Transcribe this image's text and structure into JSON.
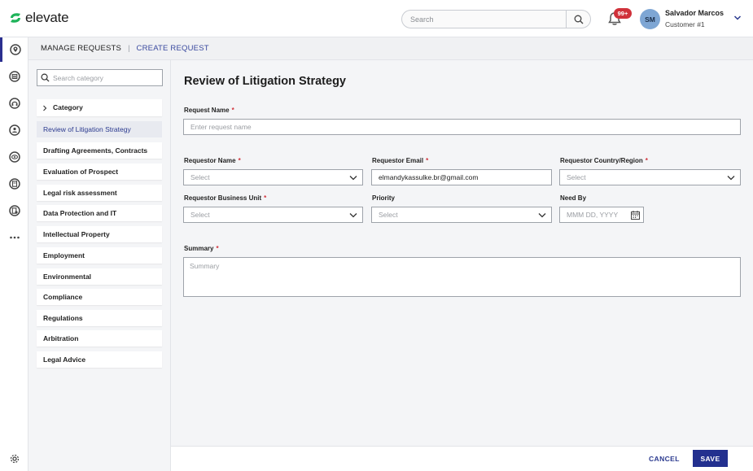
{
  "header": {
    "brand": "elevate",
    "search_placeholder": "Search",
    "notifications_badge": "99+",
    "user_initials": "SM",
    "user_name": "Salvador Marcos",
    "user_role": "Customer #1"
  },
  "breadcrumb": {
    "first": "MANAGE REQUESTS",
    "separator": "|",
    "second": "CREATE REQUEST"
  },
  "categories": {
    "search_placeholder": "Search category",
    "header_label": "Category",
    "items": [
      "Review of Litigation Strategy",
      "Drafting Agreements, Contracts",
      "Evaluation of Prospect",
      "Legal risk assessment",
      "Data Protection and IT",
      "Intellectual Property",
      "Employment",
      "Environmental",
      "Compliance",
      "Regulations",
      "Arbitration",
      "Legal Advice"
    ]
  },
  "form": {
    "title": "Review of Litigation Strategy",
    "request_name_label": "Request Name",
    "request_name_placeholder": "Enter request name",
    "requestor_name_label": "Requestor Name",
    "requestor_name_value": "Select",
    "requestor_email_label": "Requestor Email",
    "requestor_email_value": "elmandykassulke.br@gmail.com",
    "requestor_country_label": "Requestor Country/Region",
    "requestor_country_value": "Select",
    "business_unit_label": "Requestor Business Unit",
    "business_unit_value": "Select",
    "priority_label": "Priority",
    "priority_value": "Select",
    "need_by_label": "Need By",
    "need_by_placeholder": "MMM DD, YYYY",
    "summary_label": "Summary",
    "summary_placeholder": "Summary",
    "required_marker": "*"
  },
  "footer": {
    "cancel_label": "CANCEL",
    "save_label": "SAVE"
  },
  "rail_icons": [
    "location-icon",
    "reports-icon",
    "support-icon",
    "contacts-icon",
    "view-icon",
    "documents-icon",
    "billing-icon",
    "more-icon",
    "settings-icon"
  ],
  "colors": {
    "accent": "#23308f",
    "brand_green": "#1fb35a",
    "badge": "#d0313a",
    "required": "#d0313a",
    "avatar": "#7ea6d4"
  }
}
